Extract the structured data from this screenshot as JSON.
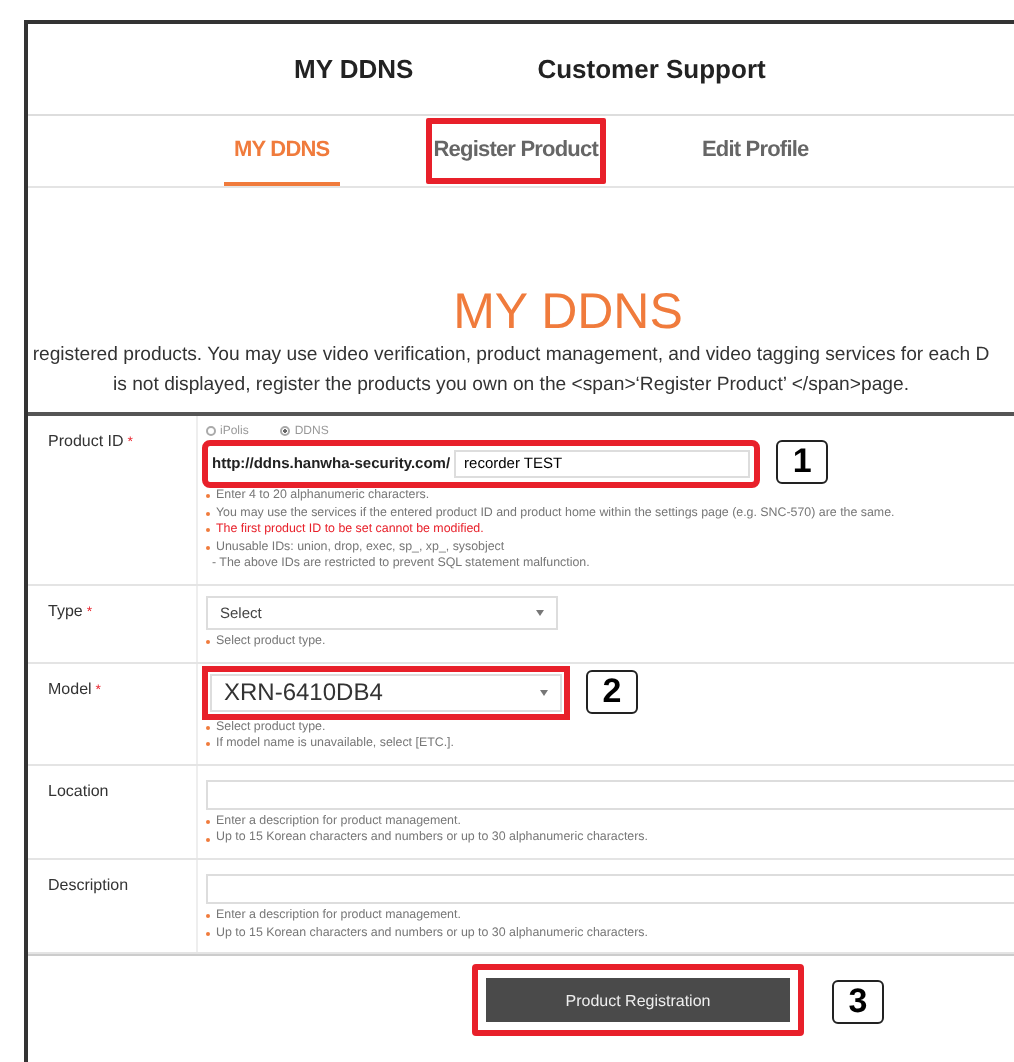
{
  "top_nav": [
    {
      "label": "MY DDNS"
    },
    {
      "label": "Customer Support"
    }
  ],
  "tabs": [
    {
      "label": "MY DDNS",
      "selected": true,
      "highlighted": false
    },
    {
      "label": "Register Product",
      "selected": false,
      "highlighted": true
    },
    {
      "label": "Edit Profile",
      "selected": false,
      "highlighted": false
    }
  ],
  "title": "MY DDNS",
  "intro": [
    "registered products. You may use video verification, product management, and video tagging services for each D",
    "is not displayed, register the products you own on the <span>‘Register Product’ </span>page."
  ],
  "form": [
    {
      "kind": "product_id",
      "label": "Product ID",
      "required_mark": "*",
      "radios": [
        {
          "label": "iPolis",
          "selected": false
        },
        {
          "label": "DDNS",
          "selected": true
        }
      ],
      "prefix": "http://ddns.hanwha-security.com/",
      "value": "recorder TEST",
      "highlighted": true,
      "callout": "1",
      "hints": [
        {
          "kind": "normal",
          "text": "Enter 4 to 20 alphanumeric characters."
        },
        {
          "kind": "normal",
          "text": "You may use the services if the entered product ID and product home within the settings page (e.g. SNC-570) are the same."
        },
        {
          "kind": "warning",
          "text": "The first product ID to be set cannot be modified."
        },
        {
          "kind": "normal",
          "text": "Unusable IDs: union, drop, exec, sp_, xp_, sysobject"
        },
        {
          "kind": "note",
          "text": "- The above IDs are restricted to prevent SQL statement malfunction."
        }
      ]
    },
    {
      "kind": "select",
      "label": "Type",
      "required_mark": "*",
      "value": "Select",
      "large": false,
      "highlighted": false,
      "hints": [
        {
          "kind": "normal",
          "text": "Select product type."
        }
      ]
    },
    {
      "kind": "select",
      "label": "Model",
      "required_mark": "*",
      "value": "XRN-6410DB4",
      "large": true,
      "highlighted": true,
      "callout": "2",
      "hints": [
        {
          "kind": "normal",
          "text": "Select product type."
        },
        {
          "kind": "normal",
          "text": "If model name is unavailable, select [ETC.]."
        }
      ]
    },
    {
      "kind": "text",
      "label": "Location",
      "hints": [
        {
          "kind": "normal",
          "text": "Enter a description for product management."
        },
        {
          "kind": "normal",
          "text": "Up to 15 Korean characters and numbers or up to 30 alphanumeric characters."
        }
      ]
    },
    {
      "kind": "text",
      "label": "Description",
      "hints": [
        {
          "kind": "normal",
          "text": "Enter a description for product management."
        },
        {
          "kind": "normal",
          "text": "Up to 15 Korean characters and numbers or up to 30 alphanumeric characters."
        }
      ]
    }
  ],
  "submit": {
    "label": "Product Registration",
    "highlighted": true,
    "callout": "3"
  }
}
